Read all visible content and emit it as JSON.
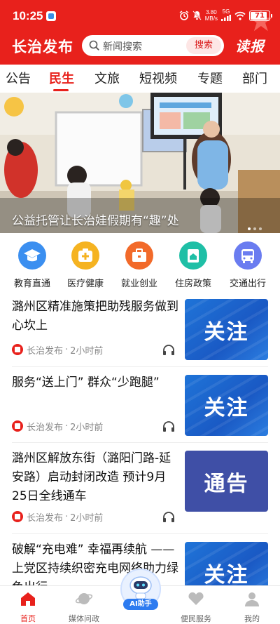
{
  "status_bar": {
    "time": "10:25",
    "net_speed_value": "3.80",
    "net_speed_unit": "MB/s",
    "signal_label": "5G",
    "battery": "71"
  },
  "header": {
    "app_title": "长治发布",
    "search_placeholder": "新闻搜索",
    "search_button": "搜索",
    "read_label": "读报",
    "brand_color": "#e8211c"
  },
  "tabs": [
    {
      "label": "公告",
      "active": false
    },
    {
      "label": "民生",
      "active": true
    },
    {
      "label": "文旅",
      "active": false
    },
    {
      "label": "短视频",
      "active": false
    },
    {
      "label": "专题",
      "active": false
    },
    {
      "label": "部门",
      "active": false
    }
  ],
  "banner": {
    "caption": "公益托管让长治娃假期有“趣”处",
    "slide_count": 3,
    "active_slide": 1
  },
  "quick_links": [
    {
      "label": "教育直通",
      "icon": "graduation-cap-icon",
      "color": "#3b8ff0"
    },
    {
      "label": "医疗健康",
      "icon": "medical-kit-icon",
      "color": "#f5b321"
    },
    {
      "label": "就业创业",
      "icon": "briefcase-icon",
      "color": "#f26a2a"
    },
    {
      "label": "住房政策",
      "icon": "house-doc-icon",
      "color": "#1fbfa6"
    },
    {
      "label": "交通出行",
      "icon": "bus-icon",
      "color": "#6a7cf0"
    }
  ],
  "news": [
    {
      "title": "潞州区精准施策把助残服务做到心坎上",
      "source": "长治发布",
      "time": "2小时前",
      "thumb_text": "关注"
    },
    {
      "title": "服务“送上门” 群众“少跑腿”",
      "source": "长治发布",
      "time": "2小时前",
      "thumb_text": "关注"
    },
    {
      "title": "潞州区解放东街（潞阳门路-延安路）启动封闭改造 预计9月25日全线通车",
      "source": "长治发布",
      "time": "2小时前",
      "thumb_text": "通告"
    },
    {
      "title": "破解“充电难” 幸福再续航 ——上党区持续织密充电网络助力绿色出行",
      "source": "",
      "time": "",
      "thumb_text": "关注"
    }
  ],
  "meta_separator": "·",
  "bottom_nav": [
    {
      "label": "首页",
      "icon": "home-icon",
      "active": true
    },
    {
      "label": "媒体问政",
      "icon": "planet-icon",
      "active": false
    },
    {
      "label": "便民服务",
      "icon": "heart-hands-icon",
      "active": false
    },
    {
      "label": "我的",
      "icon": "user-icon",
      "active": false
    }
  ],
  "ai_assistant_label": "AI助手"
}
